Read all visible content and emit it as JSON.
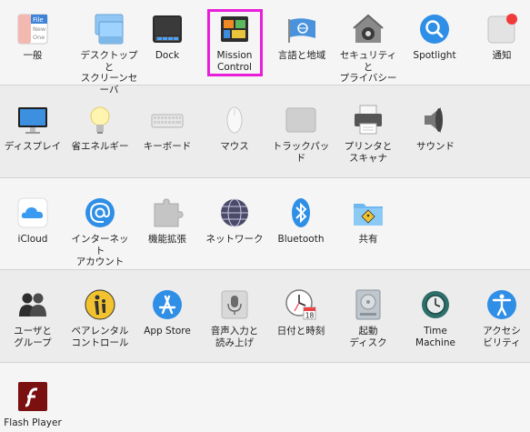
{
  "row1": {
    "general": "一般",
    "desktop": "デスクトップと\nスクリーンセーバ",
    "dock": "Dock",
    "mission": "Mission\nControl",
    "language": "言語と地域",
    "security": "セキュリティと\nプライバシー",
    "spotlight": "Spotlight",
    "notifications": "通知",
    "general_icon_lines": [
      "File",
      "New",
      "One"
    ]
  },
  "row2": {
    "display": "ディスプレイ",
    "energy": "省エネルギー",
    "keyboard": "キーボード",
    "mouse": "マウス",
    "trackpad": "トラックパッド",
    "printers": "プリンタと\nスキャナ",
    "sound": "サウンド"
  },
  "row3": {
    "icloud": "iCloud",
    "internet": "インターネット\nアカウント",
    "extensions": "機能拡張",
    "network": "ネットワーク",
    "bluetooth": "Bluetooth",
    "sharing": "共有"
  },
  "row4": {
    "users": "ユーザと\nグループ",
    "parental": "ペアレンタル\nコントロール",
    "appstore": "App Store",
    "dictation": "音声入力と\n読み上げ",
    "datetime": "日付と時刻",
    "startup": "起動\nディスク",
    "timemachine": "Time\nMachine",
    "accessibility": "アクセシ\nビリティ",
    "calendar_day": "18"
  },
  "row5": {
    "flash": "Flash Player"
  },
  "colors": {
    "selection": "#e81ed8"
  }
}
